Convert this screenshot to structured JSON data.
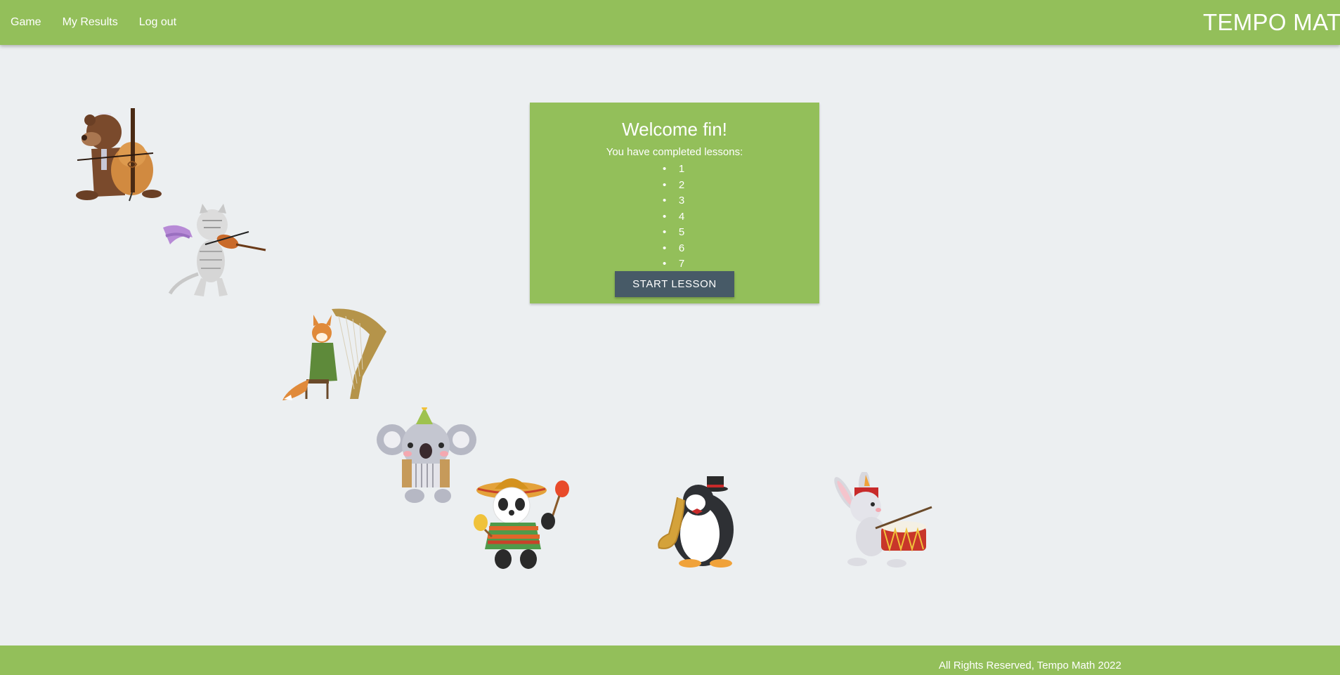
{
  "nav": {
    "links": [
      "Game",
      "My Results",
      "Log out"
    ],
    "brand": "TEMPO MATH"
  },
  "welcome": {
    "title": "Welcome fin!",
    "lessons_label": "You have completed lessons:",
    "completed_lessons": [
      "1",
      "2",
      "3",
      "4",
      "5",
      "6",
      "7"
    ],
    "start_button": "START LESSON"
  },
  "animals": [
    {
      "icon": "bear-cello-icon"
    },
    {
      "icon": "cat-violin-icon"
    },
    {
      "icon": "fox-harp-icon"
    },
    {
      "icon": "koala-accordion-icon"
    },
    {
      "icon": "panda-maracas-icon"
    },
    {
      "icon": "penguin-saxophone-icon"
    },
    {
      "icon": "rabbit-drum-icon"
    }
  ],
  "footer": {
    "text": "All Rights Reserved, Tempo Math 2022"
  },
  "colors": {
    "primary": "#93bf5a",
    "button": "#475a67",
    "background": "#eceff1"
  }
}
